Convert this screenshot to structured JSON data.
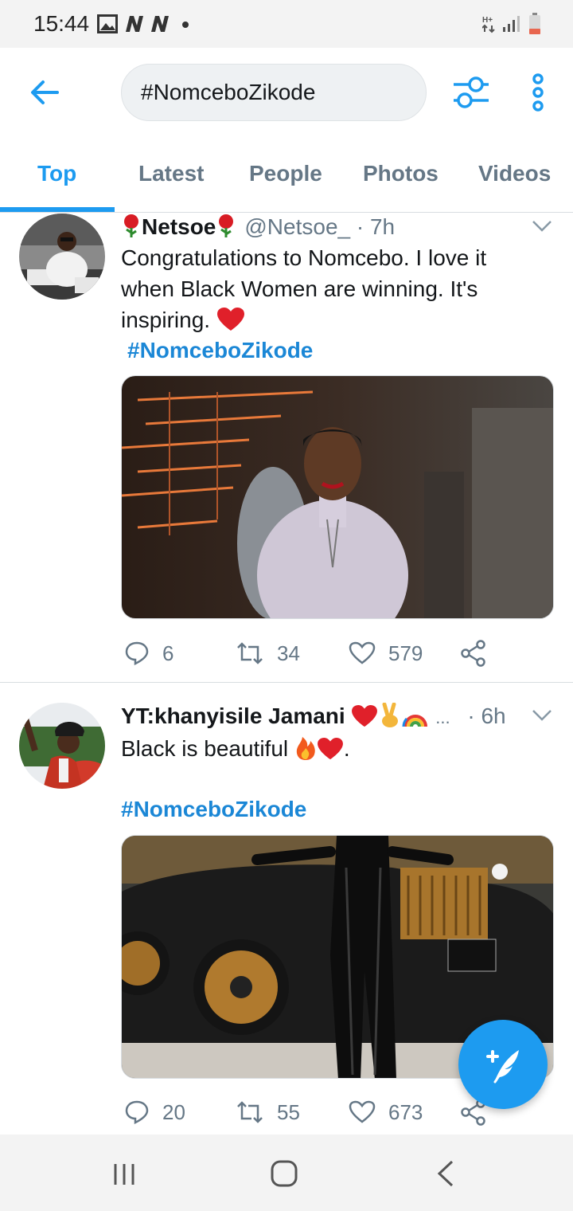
{
  "status_bar": {
    "time": "15:44",
    "icons": [
      "gallery-icon",
      "n-notification-icon",
      "n-notification-icon",
      "dot-icon",
      "data-arrows-icon",
      "signal-icon",
      "battery-icon"
    ]
  },
  "header": {
    "search_value": "#NomceboZikode",
    "icons": [
      "back-arrow-icon",
      "filter-sliders-icon",
      "more-vertical-icon"
    ]
  },
  "tabs": [
    {
      "label": "Top",
      "active": true
    },
    {
      "label": "Latest",
      "active": false
    },
    {
      "label": "People",
      "active": false
    },
    {
      "label": "Photos",
      "active": false
    },
    {
      "label": "Videos",
      "active": false
    }
  ],
  "tweets": [
    {
      "name": "Netsoe",
      "name_emoji": "rose",
      "handle": "@Netsoe_",
      "time": "· 7h",
      "text": "Congratulations to Nomcebo. I love it when Black Women are winning. It's inspiring.",
      "text_emoji": "red-heart",
      "hashtag": "#NomceboZikode",
      "media": "photo-woman-in-lilac-top",
      "replies": "6",
      "retweets": "34",
      "likes": "579"
    },
    {
      "name": "YT:khanyisile Jamani",
      "name_emoji": "heart-victory-rainbow",
      "ellipsis": "...",
      "time": "· 6h",
      "text": "Black is beautiful",
      "text_emoji": "fire-heart",
      "text_suffix": ".",
      "hashtag": "#NomceboZikode",
      "media": "photo-woman-leaning-on-car",
      "replies": "20",
      "retweets": "55",
      "likes": "673"
    }
  ],
  "colors": {
    "accent": "#1d9bf0",
    "hashtag": "#1b87d6",
    "muted": "#657786",
    "heart": "#e0202a"
  }
}
